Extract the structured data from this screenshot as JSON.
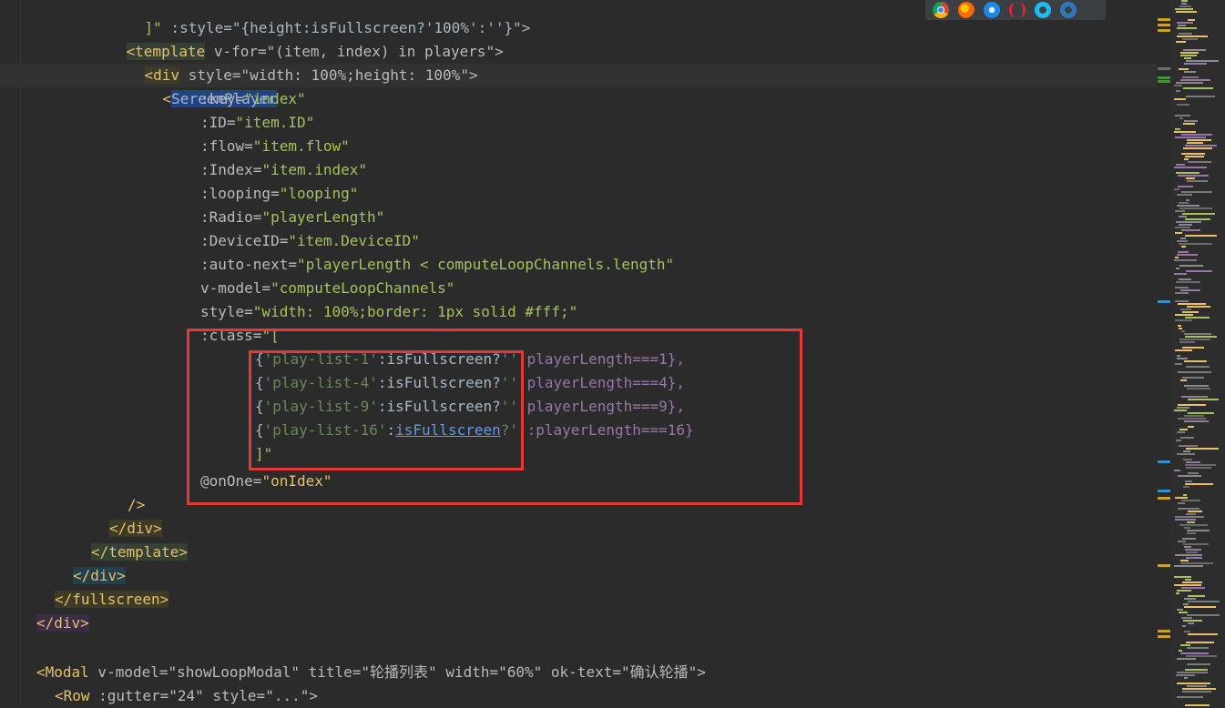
{
  "editor": {
    "lines": [
      {
        "id": "l0",
        "text_a": "]\"",
        "text_b": " :style=\"{height:isFullscreen?'100%':''}\">"
      },
      {
        "id": "l1",
        "open": "<template",
        "rest": " v-for=\"(item, index) in players\">"
      },
      {
        "id": "l2",
        "open": "<div",
        "rest": " style=\"width: 100%;height: 100%\">"
      },
      {
        "id": "l3",
        "open": "<",
        "comp": "SereenPlayer"
      }
    ],
    "attrs": [
      {
        "name": ":key=",
        "value": "\"index\""
      },
      {
        "name": ":ID=",
        "value": "\"item.ID\""
      },
      {
        "name": ":flow=",
        "value": "\"item.flow\""
      },
      {
        "name": ":Index=",
        "value": "\"item.index\""
      },
      {
        "name": ":looping=",
        "value": "\"looping\""
      },
      {
        "name": ":Radio=",
        "value": "\"playerLength\""
      },
      {
        "name": ":DeviceID=",
        "value": "\"item.DeviceID\""
      },
      {
        "name": ":auto-next=",
        "value": "\"playerLength < computeLoopChannels.length\""
      },
      {
        "name": "v-model=",
        "value": "\"computeLoopChannels\""
      },
      {
        "name": "style=",
        "value": "\"width: 100%;border: 1px solid #fff;\""
      },
      {
        "name": ":class=",
        "value": "\"["
      }
    ],
    "class_rows": [
      {
        "key": "'play-list-1'",
        "cond": ":isFullscreen?",
        "q": "''",
        "tail": ":playerLength===1},"
      },
      {
        "key": "'play-list-4'",
        "cond": ":isFullscreen?",
        "q": "''",
        "tail": ":playerLength===4},"
      },
      {
        "key": "'play-list-9'",
        "cond": ":isFullscreen?",
        "q": "''",
        "tail": ":playerLength===9},"
      },
      {
        "key": "'play-list-16'",
        "cond": "isFullscreen",
        "q": "?''",
        "tail": ":playerLength===16}"
      }
    ],
    "class_close": "]\"",
    "on_one": {
      "name": "@onOne=",
      "value": "\"onIdex\""
    },
    "self_close": "/>",
    "close_div": "</div>",
    "close_template": "</template>",
    "close_div2": "</div>",
    "close_fullscreen": "</fullscreen>",
    "close_div3": "</div>",
    "modal": {
      "open": "<Modal",
      "rest": " v-model=\"showLoopModal\" title=\"轮播列表\" width=\"60%\" ok-text=\"确认轮播\">"
    },
    "row": {
      "open": "<Row",
      "rest": " :gutter=\"24\" style=\"...\">"
    }
  },
  "browser_icons": [
    "chrome-icon",
    "firefox-icon",
    "safari-icon",
    "opera-icon",
    "ie-icon",
    "edge-icon"
  ],
  "colors": {
    "highlight_box": "#e53935",
    "background": "#2b2b2b"
  }
}
